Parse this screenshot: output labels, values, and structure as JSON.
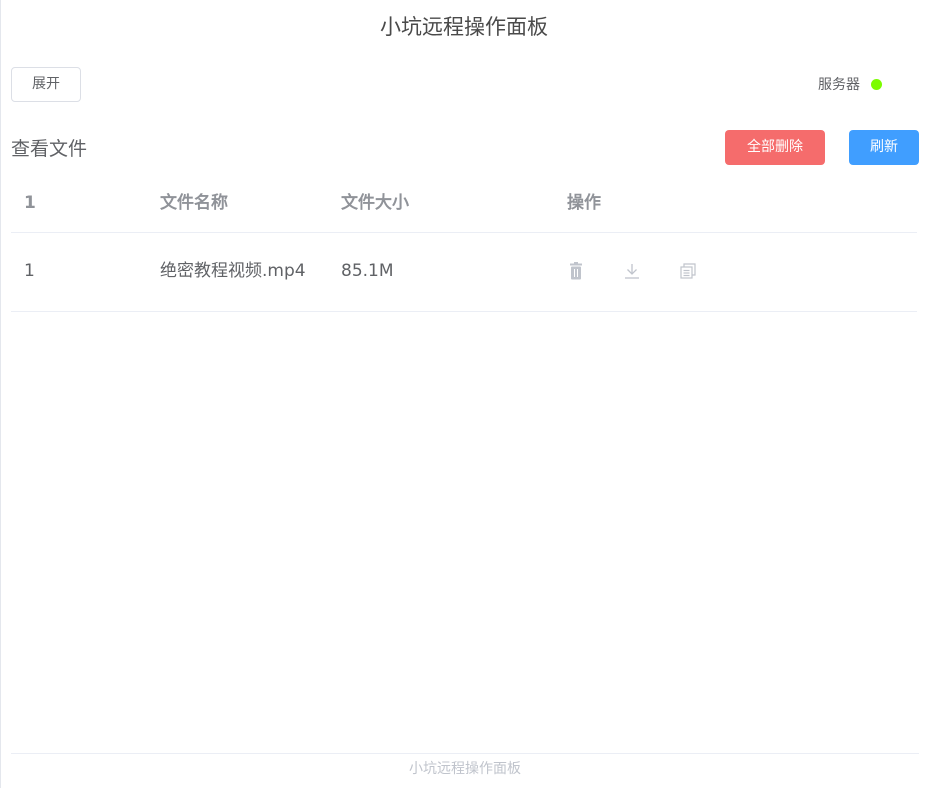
{
  "header": {
    "title": "小坑远程操作面板"
  },
  "toolbar": {
    "expand_label": "展开",
    "server_label": "服务器",
    "server_status_color": "#7cfc00"
  },
  "files": {
    "section_title": "查看文件",
    "delete_all_label": "全部删除",
    "refresh_label": "刷新",
    "delete_all_color": "#f56c6c",
    "refresh_color": "#409eff",
    "columns": {
      "index": "1",
      "name": "文件名称",
      "size": "文件大小",
      "actions": "操作"
    },
    "rows": [
      {
        "index": "1",
        "name": "绝密教程视频.mp4",
        "size": "85.1M",
        "action_icons": [
          "trash-icon",
          "download-icon",
          "copy-icon"
        ]
      }
    ]
  },
  "footer": {
    "text": "小坑远程操作面板"
  }
}
